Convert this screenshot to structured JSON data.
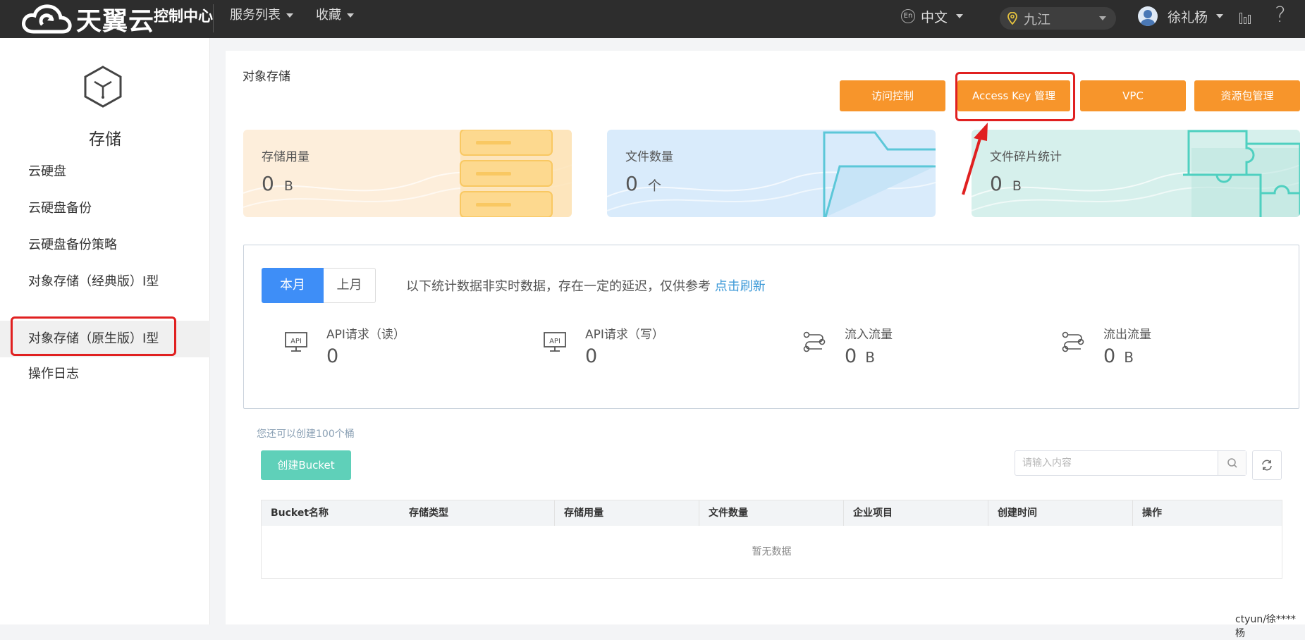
{
  "topbar": {
    "brand": "天翼云",
    "console": "控制中心",
    "nav": [
      "服务列表",
      "收藏"
    ],
    "lang_icon": "En",
    "lang": "中文",
    "region": "九江",
    "user": "徐礼杨",
    "icons": [
      "cloud-logo-icon",
      "globe-en-icon",
      "location-pin-icon",
      "avatar",
      "bar-chart-icon",
      "help-icon"
    ]
  },
  "sidebar": {
    "title": "存储",
    "items": [
      {
        "label": "云硬盘"
      },
      {
        "label": "云硬盘备份"
      },
      {
        "label": "云硬盘备份策略"
      },
      {
        "label": "对象存储（经典版）Ⅰ型"
      },
      {
        "label": "对象存储（原生版）Ⅰ型",
        "active": true
      },
      {
        "label": "操作日志"
      }
    ]
  },
  "main": {
    "title": "对象存储",
    "buttons": [
      "访问控制",
      "Access Key 管理",
      "VPC",
      "资源包管理"
    ],
    "cards": [
      {
        "label": "存储用量",
        "value": "0",
        "unit": "B"
      },
      {
        "label": "文件数量",
        "value": "0",
        "unit": "个"
      },
      {
        "label": "文件碎片统计",
        "value": "0",
        "unit": "B"
      }
    ],
    "tabs": [
      "本月",
      "上月"
    ],
    "note": "以下统计数据非实时数据，存在一定的延迟，仅供参考",
    "refresh_link": "点击刷新",
    "metrics": [
      {
        "label": "API请求（读）",
        "value": "0",
        "unit": ""
      },
      {
        "label": "API请求（写）",
        "value": "0",
        "unit": ""
      },
      {
        "label": "流入流量",
        "value": "0",
        "unit": "B"
      },
      {
        "label": "流出流量",
        "value": "0",
        "unit": "B"
      }
    ],
    "quota_note": "您还可以创建100个桶",
    "create_button": "创建Bucket",
    "search_placeholder": "请输入内容",
    "table": {
      "columns": [
        "Bucket名称",
        "存储类型",
        "存储用量",
        "文件数量",
        "企业项目",
        "创建时间",
        "操作"
      ],
      "empty": "暂无数据"
    }
  },
  "footer": {
    "user": "ctyun/徐****杨"
  },
  "colors": {
    "accent_orange": "#f7952b",
    "primary_blue": "#3e8ef7",
    "create_green": "#5fd0b9",
    "highlight_red": "#e02020"
  }
}
